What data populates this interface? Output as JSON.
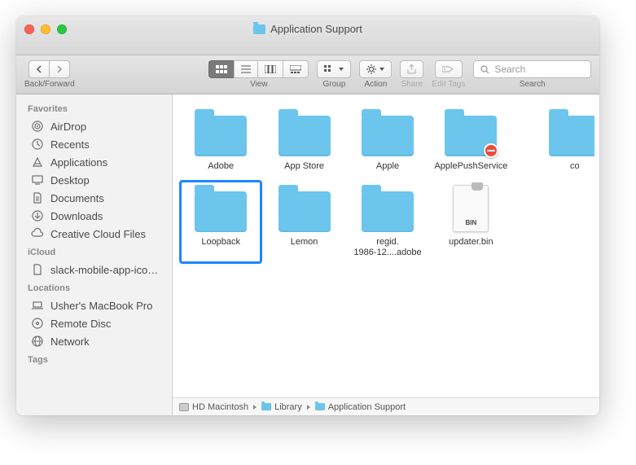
{
  "window": {
    "title": "Application Support"
  },
  "toolbar": {
    "back_forward_label": "Back/Forward",
    "view_label": "View",
    "group_label": "Group",
    "action_label": "Action",
    "share_label": "Share",
    "tags_label": "Edit Tags",
    "search_label": "Search",
    "search_placeholder": "Search"
  },
  "sidebar": {
    "favorites_header": "Favorites",
    "favorites": [
      {
        "label": "AirDrop",
        "icon": "airdrop"
      },
      {
        "label": "Recents",
        "icon": "recents"
      },
      {
        "label": "Applications",
        "icon": "applications"
      },
      {
        "label": "Desktop",
        "icon": "desktop"
      },
      {
        "label": "Documents",
        "icon": "documents"
      },
      {
        "label": "Downloads",
        "icon": "downloads"
      },
      {
        "label": "Creative Cloud Files",
        "icon": "cc"
      }
    ],
    "icloud_header": "iCloud",
    "icloud": [
      {
        "label": "slack-mobile-app-icon...",
        "icon": "file"
      }
    ],
    "locations_header": "Locations",
    "locations": [
      {
        "label": "Usher's MacBook Pro",
        "icon": "laptop"
      },
      {
        "label": "Remote Disc",
        "icon": "disc"
      },
      {
        "label": "Network",
        "icon": "globe"
      }
    ],
    "tags_header": "Tags"
  },
  "files": [
    {
      "name": "Adobe",
      "type": "folder"
    },
    {
      "name": "App Store",
      "type": "folder"
    },
    {
      "name": "Apple",
      "type": "folder"
    },
    {
      "name": "ApplePushService",
      "type": "folder",
      "badge": "no"
    },
    {
      "name": "co",
      "type": "folder",
      "partial": true
    },
    {
      "name": "Loopback",
      "type": "folder",
      "selected": true
    },
    {
      "name": "Lemon",
      "type": "folder"
    },
    {
      "name": "regid.\n1986-12....adobe",
      "type": "folder"
    },
    {
      "name": "updater.bin",
      "type": "bin"
    }
  ],
  "pathbar": {
    "crumbs": [
      {
        "label": "HD Macintosh",
        "icon": "hd"
      },
      {
        "label": "Library",
        "icon": "folder"
      },
      {
        "label": "Application Support",
        "icon": "folder"
      }
    ]
  }
}
